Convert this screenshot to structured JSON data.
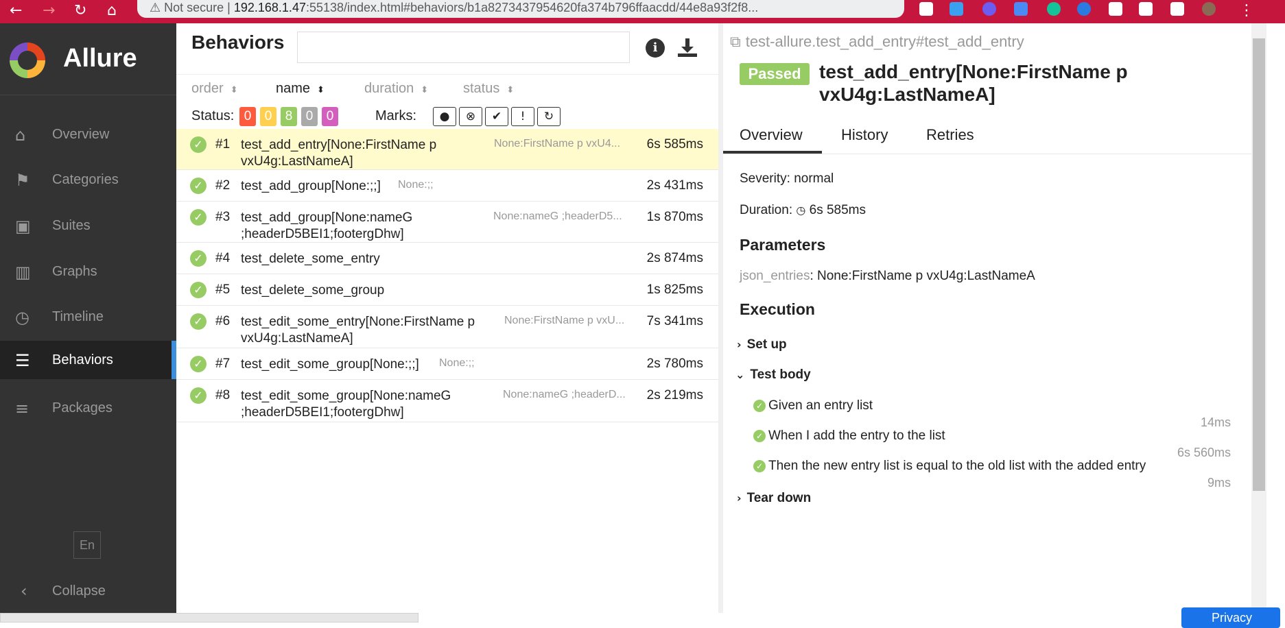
{
  "browser": {
    "url_prefix": "⚠ Not secure  |  ",
    "url_host": "192.168.1.47",
    "url_rest": ":55138/index.html#behaviors/b1a827343795462​0fa374b796ffaacdd/44e8a93f2f8..."
  },
  "sidebar": {
    "brand": "Allure",
    "items": [
      {
        "label": "Overview",
        "icon": "home-icon",
        "glyph": "⌂"
      },
      {
        "label": "Categories",
        "icon": "flag-icon",
        "glyph": "⚑"
      },
      {
        "label": "Suites",
        "icon": "briefcase-icon",
        "glyph": "▣"
      },
      {
        "label": "Graphs",
        "icon": "bar-chart-icon",
        "glyph": "▥"
      },
      {
        "label": "Timeline",
        "icon": "clock-icon",
        "glyph": "◷"
      },
      {
        "label": "Behaviors",
        "icon": "list-icon",
        "glyph": "☰"
      },
      {
        "label": "Packages",
        "icon": "align-left-icon",
        "glyph": "≡"
      }
    ],
    "active": "Behaviors",
    "language": "En",
    "collapse": "Collapse"
  },
  "middle": {
    "title": "Behaviors",
    "sort": {
      "order": "order",
      "name": "name",
      "duration": "duration",
      "status": "status"
    },
    "status_label": "Status:",
    "counts": [
      {
        "value": "0",
        "color": "#fd5a3e"
      },
      {
        "value": "0",
        "color": "#ffd050"
      },
      {
        "value": "8",
        "color": "#97cc64"
      },
      {
        "value": "0",
        "color": "#aaaaaa"
      },
      {
        "value": "0",
        "color": "#d35ebe"
      }
    ],
    "marks_label": "Marks:",
    "marks": [
      "flaky-icon",
      "new-failed-icon",
      "new-passed-icon",
      "new-broken-icon",
      "retries-icon"
    ],
    "rows": [
      {
        "num": "#1",
        "name": "test_add_entry[None:FirstName p vxU4g:LastNameA]",
        "param": "None:FirstName p vxU4...",
        "duration": "6s 585ms"
      },
      {
        "num": "#2",
        "name": "test_add_group[None:;;]",
        "param": "None:;;",
        "duration": "2s 431ms"
      },
      {
        "num": "#3",
        "name": "test_add_group[None:nameG ;headerD5BEI1;footergDhw]",
        "param": "None:nameG ;headerD5...",
        "duration": "1s 870ms"
      },
      {
        "num": "#4",
        "name": "test_delete_some_entry",
        "param": "",
        "duration": "2s 874ms"
      },
      {
        "num": "#5",
        "name": "test_delete_some_group",
        "param": "",
        "duration": "1s 825ms"
      },
      {
        "num": "#6",
        "name": "test_edit_some_entry[None:FirstName p vxU4g:LastNameA]",
        "param": "None:FirstName p vxU...",
        "duration": "7s 341ms"
      },
      {
        "num": "#7",
        "name": "test_edit_some_group[None:;;]",
        "param": "None:;;",
        "duration": "2s 780ms"
      },
      {
        "num": "#8",
        "name": "test_edit_some_group[None:nameG ;headerD5BEI1;footergDhw]",
        "param": "None:nameG ;headerD...",
        "duration": "2s 219ms"
      }
    ]
  },
  "detail": {
    "breadcrumb": "test-allure.test_add_entry#test_add_entry",
    "status": "Passed",
    "title": "test_add_entry[None:FirstName p vxU4g:LastNameA]",
    "tabs": [
      "Overview",
      "History",
      "Retries"
    ],
    "severity": "Severity: normal",
    "duration_label": "Duration:",
    "duration": "6s 585ms",
    "parameters_heading": "Parameters",
    "param_key": "json_entries",
    "param_value": ": None:FirstName p vxU4g:LastNameA",
    "execution_heading": "Execution",
    "setup": "Set up",
    "test_body": "Test body",
    "steps": [
      {
        "name": "Given an entry list",
        "duration": "14ms"
      },
      {
        "name": "When I add the entry to the list",
        "duration": "6s 560ms"
      },
      {
        "name": "Then the new entry list is equal to the old list with the added entry",
        "duration": "9ms"
      }
    ],
    "teardown": "Tear down"
  },
  "privacy": "Privacy"
}
